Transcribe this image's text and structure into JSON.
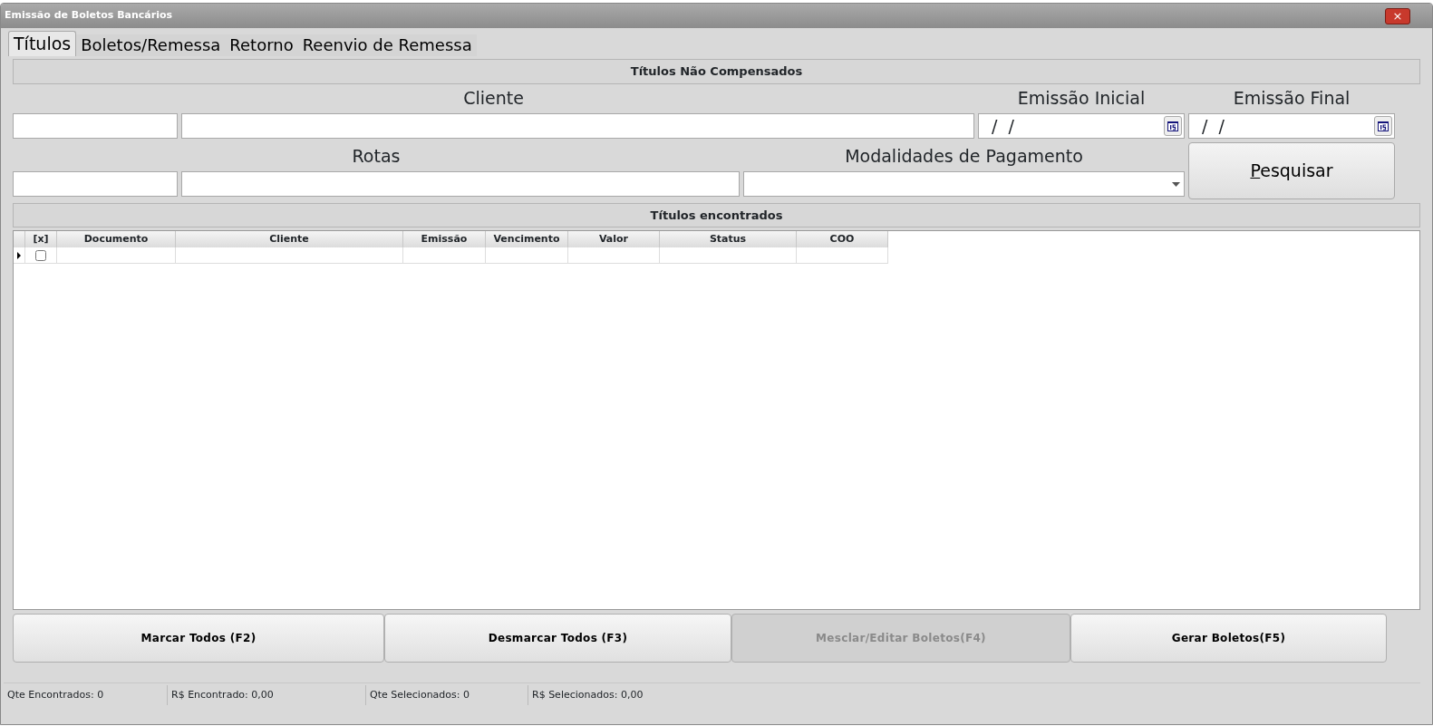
{
  "window": {
    "title": "Emissão de Boletos Bancários",
    "close": "×"
  },
  "tabs": [
    {
      "label": "Títulos",
      "selected": true
    },
    {
      "label": "Boletos/Remessa",
      "selected": false
    },
    {
      "label": "Retorno",
      "selected": false
    },
    {
      "label": "Reenvio de Remessa",
      "selected": false
    }
  ],
  "filter_section": {
    "title": "Títulos Não Compensados"
  },
  "filters": {
    "cliente_label": "Cliente",
    "emissao_inicial": {
      "label": "Emissão Inicial",
      "value": " /  /"
    },
    "emissao_final": {
      "label": "Emissão Final",
      "value": " /  /"
    },
    "rotas_label": "Rotas",
    "modalidades_label": "Modalidades de Pagamento",
    "search_button": "Pesquisar"
  },
  "results_section": {
    "title": "Títulos encontrados"
  },
  "grid": {
    "columns": [
      "[x]",
      "Documento",
      "Cliente",
      "Emissão",
      "Vencimento",
      "Valor",
      "Status",
      "COO"
    ],
    "rows": [
      {
        "current": true,
        "checked": false
      }
    ]
  },
  "buttons": [
    {
      "label": "Marcar Todos (F2)",
      "disabled": false
    },
    {
      "label": "Desmarcar Todos (F3)",
      "disabled": false
    },
    {
      "label": "Mesclar/Editar Boletos(F4)",
      "disabled": true
    },
    {
      "label": "Gerar Boletos(F5)",
      "disabled": false
    }
  ],
  "status_bar": [
    "Qte Encontrados: 0",
    "R$ Encontrado: 0,00",
    "Qte Selecionados: 0",
    "R$ Selecionados: 0,00"
  ]
}
